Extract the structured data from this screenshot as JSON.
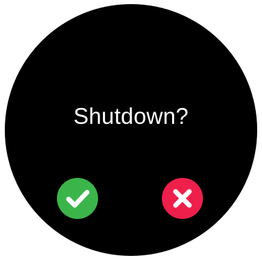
{
  "dialog": {
    "prompt": "Shutdown?"
  },
  "actions": {
    "confirm": {
      "icon": "checkmark-icon",
      "color": "#3bb54a"
    },
    "cancel": {
      "icon": "close-icon",
      "color": "#ef1f4b"
    }
  },
  "theme": {
    "background": "#000000",
    "text_color": "#ffffff"
  }
}
